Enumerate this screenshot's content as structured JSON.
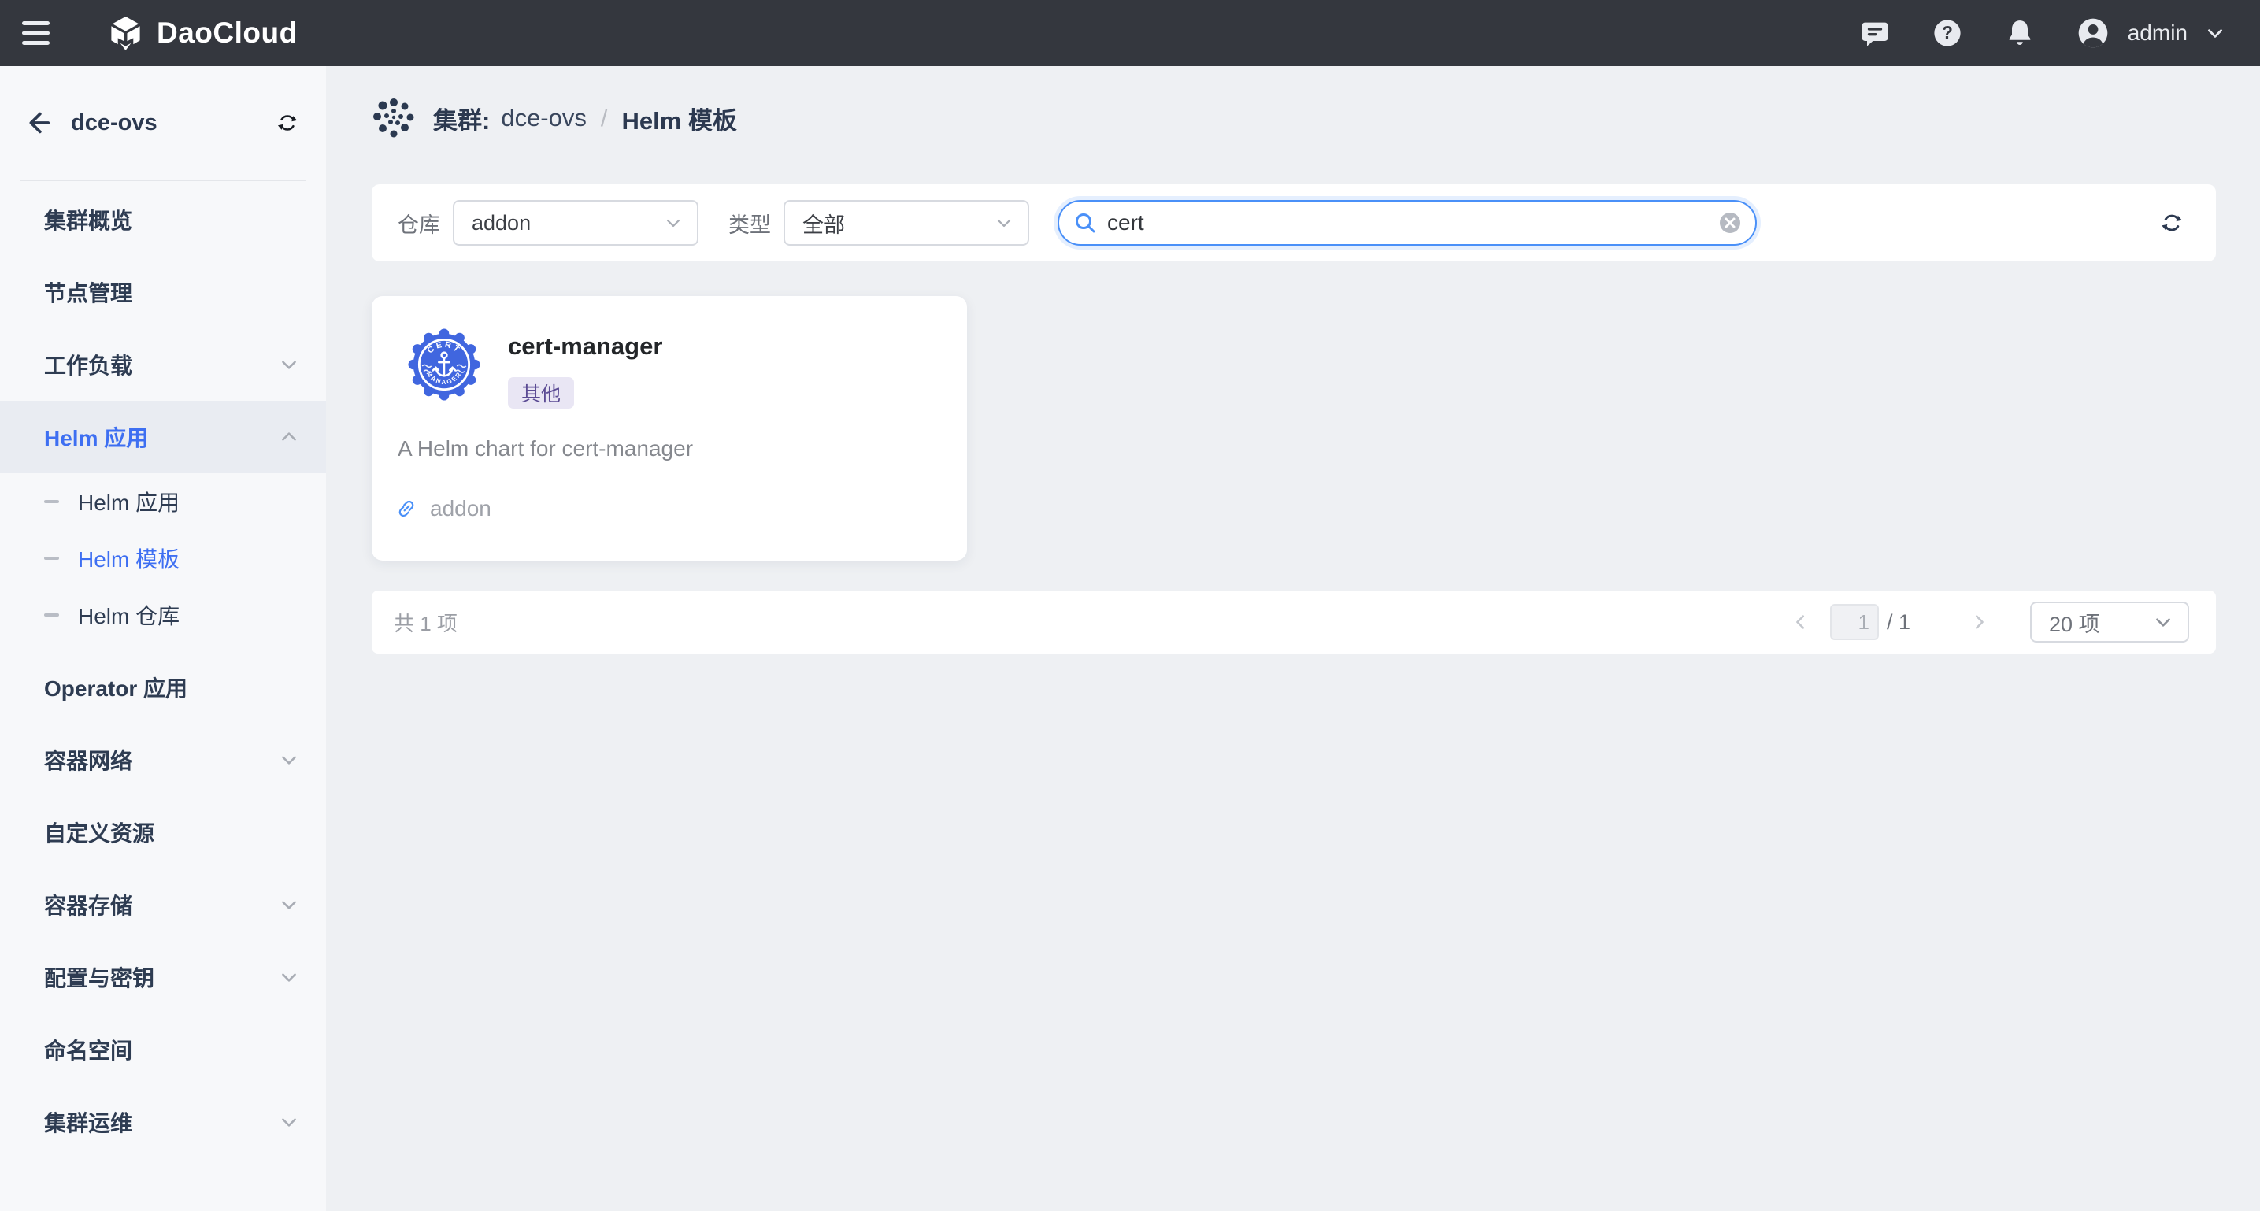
{
  "topbar": {
    "brand": "DaoCloud",
    "user": "admin"
  },
  "sidebar": {
    "cluster": "dce-ovs",
    "items": [
      {
        "label": "集群概览",
        "expandable": false,
        "active": false
      },
      {
        "label": "节点管理",
        "expandable": false,
        "active": false
      },
      {
        "label": "工作负载",
        "expandable": true,
        "active": false
      },
      {
        "label": "Helm 应用",
        "expandable": true,
        "active": true,
        "expanded": true,
        "children": [
          {
            "label": "Helm 应用",
            "active": false
          },
          {
            "label": "Helm 模板",
            "active": true
          },
          {
            "label": "Helm 仓库",
            "active": false
          }
        ]
      },
      {
        "label": "Operator 应用",
        "expandable": false,
        "active": false
      },
      {
        "label": "容器网络",
        "expandable": true,
        "active": false
      },
      {
        "label": "自定义资源",
        "expandable": false,
        "active": false
      },
      {
        "label": "容器存储",
        "expandable": true,
        "active": false
      },
      {
        "label": "配置与密钥",
        "expandable": true,
        "active": false
      },
      {
        "label": "命名空间",
        "expandable": false,
        "active": false
      },
      {
        "label": "集群运维",
        "expandable": true,
        "active": false
      }
    ]
  },
  "breadcrumb": {
    "prefix": "集群:",
    "cluster": "dce-ovs",
    "separator": "/",
    "current": "Helm 模板"
  },
  "filters": {
    "repo_label": "仓库",
    "repo_value": "addon",
    "type_label": "类型",
    "type_value": "全部",
    "search_value": "cert"
  },
  "card": {
    "title": "cert-manager",
    "tag": "其他",
    "description": "A Helm chart for cert-manager",
    "repo": "addon",
    "logo_text_top": "CERT",
    "logo_text_bottom": "MANAGER"
  },
  "pagination": {
    "total": "共 1 项",
    "page": "1",
    "of": "/ 1",
    "page_size": "20 项"
  },
  "colors": {
    "accent_blue": "#3e6ff2",
    "search_border": "#4a90f8",
    "topbar_bg": "#34373e",
    "sidebar_bg": "#f7f8fa",
    "sidebar_active_bg": "#e9ecf2",
    "main_bg": "#eef0f3",
    "tag_bg": "#e9e6f4",
    "tag_text": "#5b4b94",
    "logo_blue": "#4066df",
    "text_navy": "#2e3c52"
  }
}
